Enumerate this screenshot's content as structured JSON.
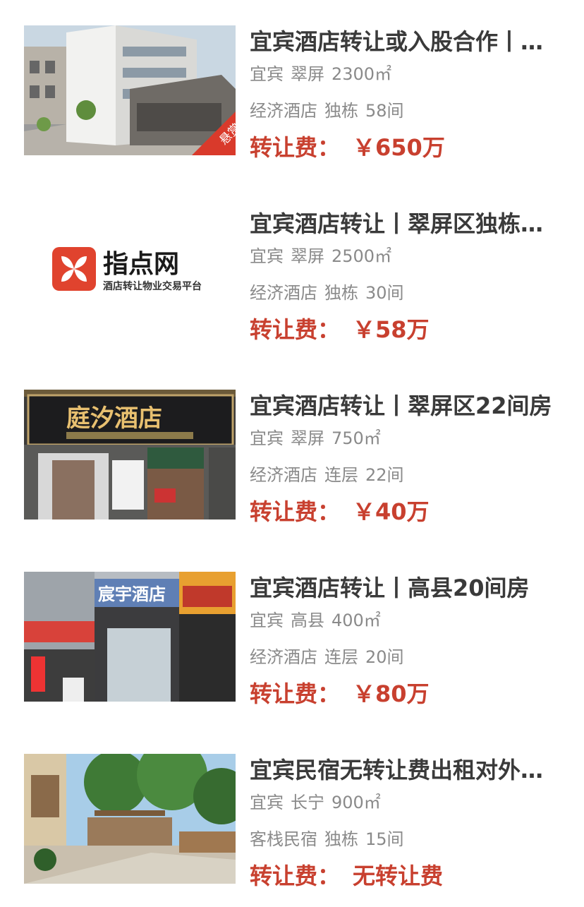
{
  "listings": [
    {
      "title": "宜宾酒店转让或入股合作丨宜宾翠屏区独栋酒店转让",
      "city": "宜宾",
      "district": "翠屏",
      "area": "2300㎡",
      "type": "经济酒店",
      "building": "独栋",
      "rooms": "58间",
      "price_label": "转让费：",
      "price": "￥650万",
      "badge": "悬赏",
      "thumb": "building-render"
    },
    {
      "title": "宜宾酒店转让丨翠屏区独栋酒店转让",
      "city": "宜宾",
      "district": "翠屏",
      "area": "2500㎡",
      "type": "经济酒店",
      "building": "独栋",
      "rooms": "30间",
      "price_label": "转让费：",
      "price": "￥58万",
      "thumb": "logo",
      "logo_name": "指点网",
      "logo_tagline": "酒店转让物业交易平台"
    },
    {
      "title": "宜宾酒店转让丨翠屏区22间房",
      "city": "宜宾",
      "district": "翠屏",
      "area": "750㎡",
      "type": "经济酒店",
      "building": "连层",
      "rooms": "22间",
      "price_label": "转让费：",
      "price": "￥40万",
      "thumb": "storefront",
      "sign_text": "庭汐酒店"
    },
    {
      "title": "宜宾酒店转让丨高县20间房",
      "city": "宜宾",
      "district": "高县",
      "area": "400㎡",
      "type": "经济酒店",
      "building": "连层",
      "rooms": "20间",
      "price_label": "转让费：",
      "price": "￥80万",
      "thumb": "street",
      "sign_text": "宸宇酒店"
    },
    {
      "title": "宜宾民宿无转让费出租对外经营",
      "city": "宜宾",
      "district": "长宁",
      "area": "900㎡",
      "type": "客栈民宿",
      "building": "独栋",
      "rooms": "15间",
      "price_label": "转让费：",
      "price": "无转让费",
      "thumb": "garden"
    }
  ],
  "colors": {
    "price": "#c8402f",
    "title": "#3a3a3a",
    "meta": "#8a8a8a",
    "logo_red": "#e0432e",
    "badge": "#d93a2b"
  }
}
